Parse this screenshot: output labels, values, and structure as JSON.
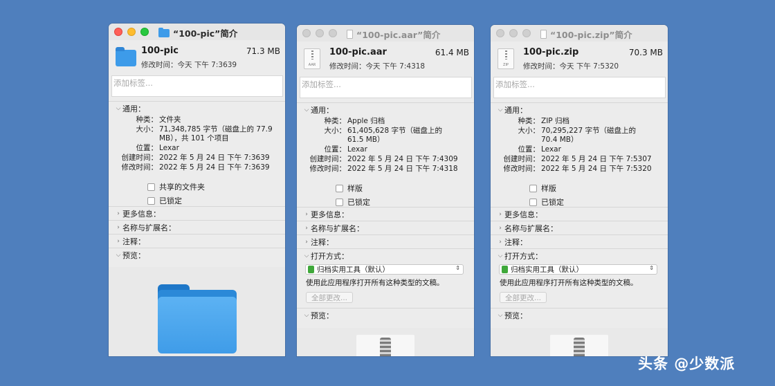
{
  "windows": [
    {
      "title": "“100-pic”简介",
      "file_name": "100-pic",
      "file_size": "71.3 MB",
      "modified": "修改时间：今天 下午 7:3639",
      "tags_placeholder": "添加标签...",
      "general_label": "通用：",
      "kind_label": "种类：",
      "kind": "文件夹",
      "size_label": "大小：",
      "size_line1": "71,348,785 字节（磁盘上的 77.9",
      "size_line2": "MB），共 101 个项目",
      "where_label": "位置：",
      "where": "Lexar",
      "created_label": "创建时间：",
      "created": "2022 年 5 月 24 日 下午 7:3639",
      "modified_label": "修改时间：",
      "modified_full": "2022 年 5 月 24 日 下午 7:3639",
      "check1": "共享的文件夹",
      "check2": "已锁定",
      "more_info": "更多信息：",
      "name_ext": "名称与扩展名：",
      "comments": "注释：",
      "preview": "预览："
    },
    {
      "title": "“100-pic.aar”简介",
      "file_name": "100-pic.aar",
      "file_size": "61.4 MB",
      "modified": "修改时间：今天 下午 7:4318",
      "icon_ext": "AAR",
      "tags_placeholder": "添加标签...",
      "general_label": "通用：",
      "kind_label": "种类：",
      "kind": "Apple 归档",
      "size_label": "大小：",
      "size_line1": "61,405,628 字节（磁盘上的",
      "size_line2": "61.5 MB）",
      "where_label": "位置：",
      "where": "Lexar",
      "created_label": "创建时间：",
      "created": "2022 年 5 月 24 日 下午 7:4309",
      "modified_label": "修改时间：",
      "modified_full": "2022 年 5 月 24 日 下午 7:4318",
      "check1": "样版",
      "check2": "已锁定",
      "more_info": "更多信息：",
      "name_ext": "名称与扩展名：",
      "comments": "注释：",
      "open_with": "打开方式：",
      "app": "归档实用工具（默认）",
      "open_desc": "使用此应用程序打开所有这种类型的文稿。",
      "change_all": "全部更改...",
      "preview": "预览："
    },
    {
      "title": "“100-pic.zip”简介",
      "file_name": "100-pic.zip",
      "file_size": "70.3 MB",
      "modified": "修改时间：今天 下午 7:5320",
      "icon_ext": "ZIP",
      "tags_placeholder": "添加标签...",
      "general_label": "通用：",
      "kind_label": "种类：",
      "kind": "ZIP 归档",
      "size_label": "大小：",
      "size_line1": "70,295,227 字节（磁盘上的",
      "size_line2": "70.4 MB）",
      "where_label": "位置：",
      "where": "Lexar",
      "created_label": "创建时间：",
      "created": "2022 年 5 月 24 日 下午 7:5307",
      "modified_label": "修改时间：",
      "modified_full": "2022 年 5 月 24 日 下午 7:5320",
      "check1": "样版",
      "check2": "已锁定",
      "more_info": "更多信息：",
      "name_ext": "名称与扩展名：",
      "comments": "注释：",
      "open_with": "打开方式：",
      "app": "归档实用工具（默认）",
      "open_desc": "使用此应用程序打开所有这种类型的文稿。",
      "change_all": "全部更改...",
      "preview": "预览："
    }
  ],
  "watermark": "头条 @少数派"
}
